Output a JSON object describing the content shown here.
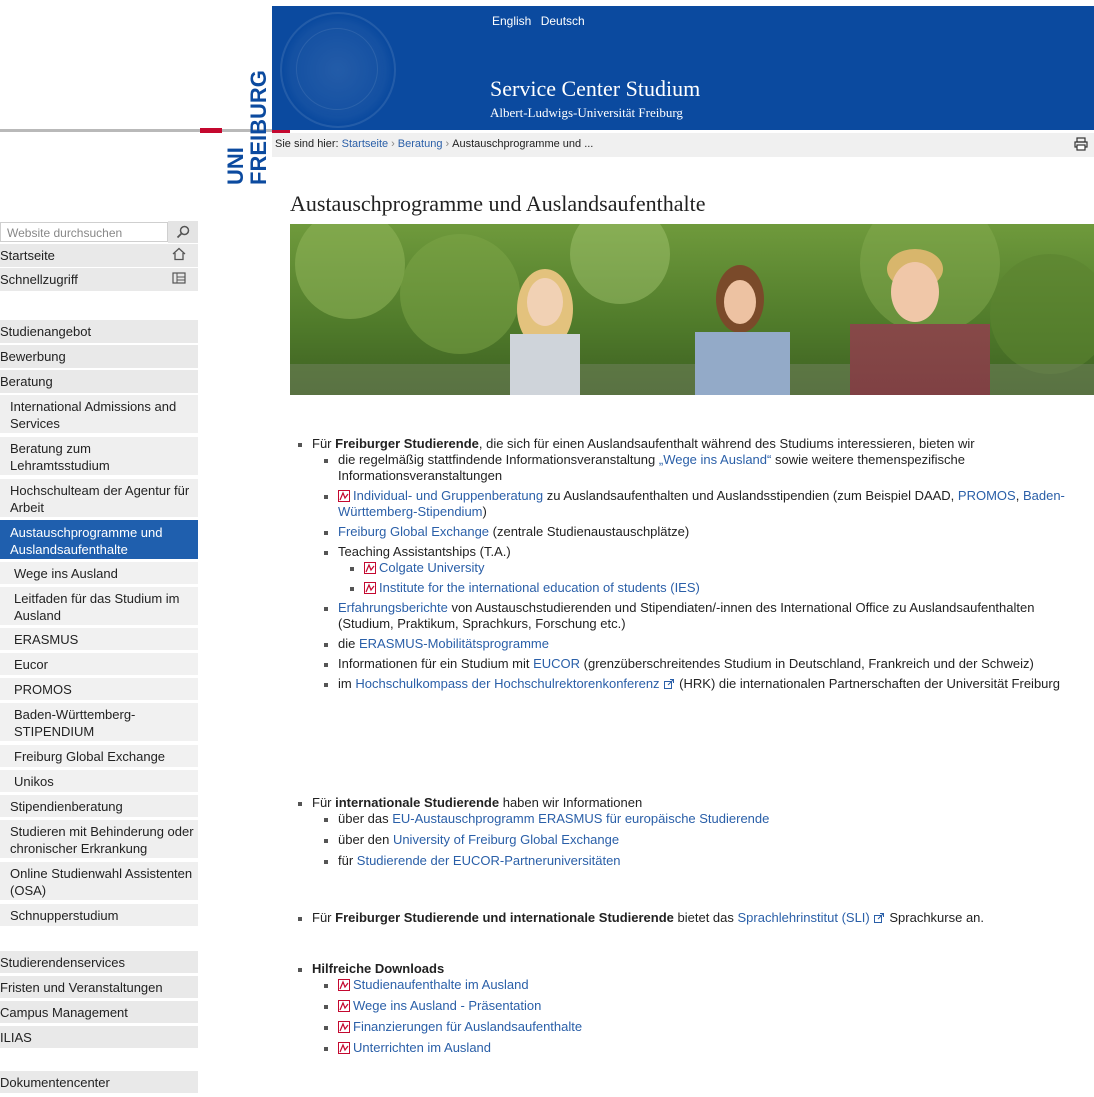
{
  "header": {
    "languages": [
      "English",
      "Deutsch"
    ],
    "site_title": "Service Center Studium",
    "site_subtitle": "Albert-Ludwigs-Universität Freiburg",
    "logo_line1": "UNI",
    "logo_line2": "FREIBURG",
    "brand_color": "#0b4a9f",
    "accent_red": "#c4082f"
  },
  "breadcrumb": {
    "prefix": "Sie sind hier:",
    "items": [
      "Startseite",
      "Beratung",
      "Austauschprogramme und ..."
    ],
    "print_icon": "print-icon"
  },
  "sidebar": {
    "search_placeholder": "Website durchsuchen",
    "top_items": [
      {
        "label": "Startseite",
        "icon": "home-icon"
      },
      {
        "label": "Schnellzugriff",
        "icon": "quickaccess-icon"
      }
    ],
    "nav": [
      "Studienangebot",
      "Bewerbung",
      "Beratung",
      "International Admissions and Services",
      "Beratung zum Lehramtsstudium",
      "Hochschulteam der Agentur für Arbeit",
      "Austauschprogramme und Auslandsaufenthalte",
      "Wege ins Ausland",
      "Leitfaden für das Studium im Ausland",
      "ERASMUS",
      "Eucor",
      "PROMOS",
      "Baden-Württemberg-STIPENDIUM",
      "Freiburg Global Exchange",
      "Unikos",
      "Stipendienberatung",
      "Studieren mit Behinderung oder chronischer Erkrankung",
      "Online Studienwahl Assistenten (OSA)",
      "Schnupperstudium",
      "Studierendenservices",
      "Fristen und Veranstaltungen",
      "Campus Management",
      "ILIAS",
      "Dokumentencenter"
    ]
  },
  "content": {
    "title": "Austauschprogramme und Auslandsaufenthalte",
    "s1": {
      "pre": "Für ",
      "bold": "Freiburger Studierende",
      "post": ", die sich für einen Auslandsaufenthalt während des Studiums interessieren, bieten wir",
      "i1_pre": "die regelmäßig stattfindende Informationsveranstaltung ",
      "i1_link": "„Wege ins Ausland“",
      "i1_post": " sowie weitere themenspezifische Informationsveranstaltungen",
      "i2_link": "Individual- und Gruppenberatung",
      "i2_mid": " zu Auslandsaufenthalten und Auslandsstipendien (zum Beispiel DAAD, ",
      "i2_link2": "PROMOS",
      "i2_sep": ", ",
      "i2_link3": "Baden-Württemberg-Stipendium",
      "i2_post": ")",
      "i3_link": "Freiburg Global Exchange",
      "i3_post": " (zentrale Studienaustauschplätze)",
      "i4": "Teaching Assistantships (T.A.)",
      "i4a": "Colgate University",
      "i4b": "Institute for the international education of students (IES)",
      "i5_link": "Erfahrungsberichte",
      "i5_post": " von Austauschstudierenden und Stipendiaten/-innen des International Office zu Auslandsaufenthalten (Studium, Praktikum, Sprachkurs, Forschung etc.)",
      "i6_pre": "die ",
      "i6_link": "ERASMUS-Mobilitätsprogramme",
      "i7_pre": "Informationen für ein Studium mit ",
      "i7_link": "EUCOR",
      "i7_post": " (grenzüberschreitendes Studium in Deutschland, Frankreich und der Schweiz)",
      "i8_pre": "im ",
      "i8_link": "Hochschulkompass der Hochschulrektorenkonferenz",
      "i8_post": " (HRK) die internationalen Partnerschaften der Universität Freiburg"
    },
    "s2": {
      "pre": "Für ",
      "bold": "internationale Studierende",
      "post": " haben wir Informationen",
      "i1_pre": "über das ",
      "i1_link": "EU-Austauschprogramm ERASMUS für europäische Studierende",
      "i2_pre": "über den ",
      "i2_link": "University of Freiburg Global Exchange",
      "i3_pre": "für ",
      "i3_link": "Studierende der EUCOR-Partneruniversitäten"
    },
    "s3": {
      "pre": "Für ",
      "bold": "Freiburger Studierende und internationale Studierende",
      "mid": " bietet das ",
      "link": "Sprachlehrinstitut (SLI)",
      "post": " Sprachkurse an."
    },
    "s4": {
      "title": "Hilfreiche Downloads",
      "items": [
        "Studienaufenthalte im Ausland",
        "Wege ins Ausland - Präsentation",
        "Finanzierungen für Auslandsaufenthalte",
        "Unterrichten im Ausland"
      ]
    }
  }
}
